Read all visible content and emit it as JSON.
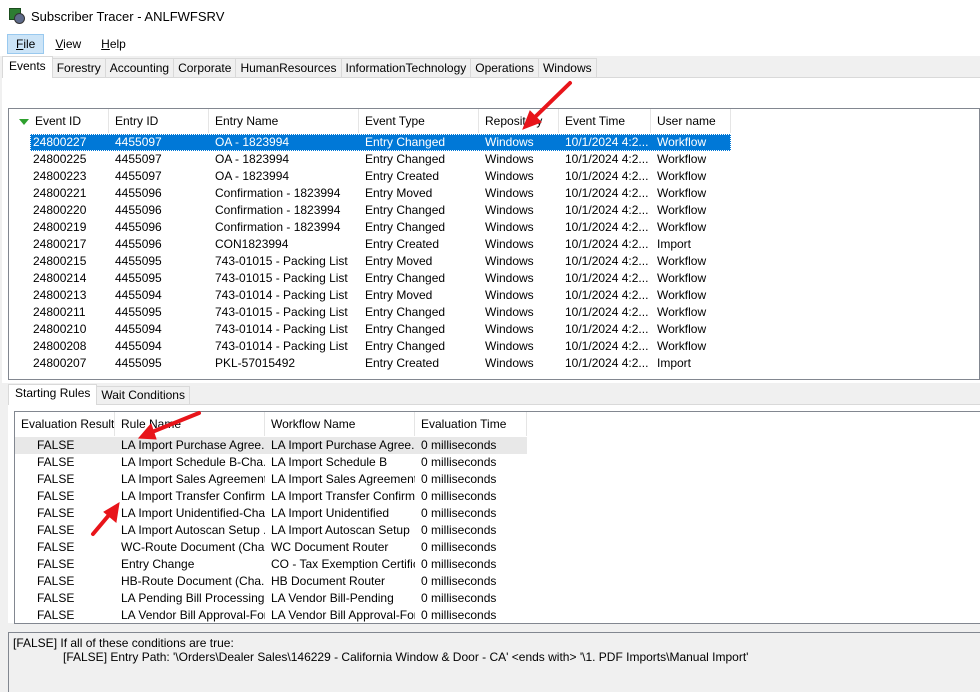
{
  "window": {
    "title": "Subscriber Tracer - ANLFWFSRV"
  },
  "menu": [
    {
      "label_u": "F",
      "label_rest": "ile"
    },
    {
      "label_u": "V",
      "label_rest": "iew"
    },
    {
      "label_u": "H",
      "label_rest": "elp"
    }
  ],
  "tabs": [
    "Events",
    "Forestry",
    "Accounting",
    "Corporate",
    "HumanResources",
    "InformationTechnology",
    "Operations",
    "Windows"
  ],
  "events": {
    "columns": [
      "Event ID",
      "Entry ID",
      "Entry Name",
      "Event Type",
      "Repository",
      "Event Time",
      "User name"
    ],
    "rows": [
      [
        "24800227",
        "4455097",
        "OA - 1823994",
        "Entry Changed",
        "Windows",
        "10/1/2024 4:2...",
        "Workflow"
      ],
      [
        "24800225",
        "4455097",
        "OA - 1823994",
        "Entry Changed",
        "Windows",
        "10/1/2024 4:2...",
        "Workflow"
      ],
      [
        "24800223",
        "4455097",
        "OA - 1823994",
        "Entry Created",
        "Windows",
        "10/1/2024 4:2...",
        "Workflow"
      ],
      [
        "24800221",
        "4455096",
        "Confirmation - 1823994",
        "Entry Moved",
        "Windows",
        "10/1/2024 4:2...",
        "Workflow"
      ],
      [
        "24800220",
        "4455096",
        "Confirmation - 1823994",
        "Entry Changed",
        "Windows",
        "10/1/2024 4:2...",
        "Workflow"
      ],
      [
        "24800219",
        "4455096",
        "Confirmation - 1823994",
        "Entry Changed",
        "Windows",
        "10/1/2024 4:2...",
        "Workflow"
      ],
      [
        "24800217",
        "4455096",
        "CON1823994",
        "Entry Created",
        "Windows",
        "10/1/2024 4:2...",
        "Import"
      ],
      [
        "24800215",
        "4455095",
        "743-01015 - Packing List",
        "Entry Moved",
        "Windows",
        "10/1/2024 4:2...",
        "Workflow"
      ],
      [
        "24800214",
        "4455095",
        "743-01015 - Packing List",
        "Entry Changed",
        "Windows",
        "10/1/2024 4:2...",
        "Workflow"
      ],
      [
        "24800213",
        "4455094",
        "743-01014 - Packing List",
        "Entry Moved",
        "Windows",
        "10/1/2024 4:2...",
        "Workflow"
      ],
      [
        "24800211",
        "4455095",
        "743-01015 - Packing List",
        "Entry Changed",
        "Windows",
        "10/1/2024 4:2...",
        "Workflow"
      ],
      [
        "24800210",
        "4455094",
        "743-01014 - Packing List",
        "Entry Changed",
        "Windows",
        "10/1/2024 4:2...",
        "Workflow"
      ],
      [
        "24800208",
        "4455094",
        "743-01014 - Packing List",
        "Entry Changed",
        "Windows",
        "10/1/2024 4:2...",
        "Workflow"
      ],
      [
        "24800207",
        "4455095",
        "PKL-57015492",
        "Entry Created",
        "Windows",
        "10/1/2024 4:2...",
        "Import"
      ]
    ]
  },
  "subtabs": [
    "Starting Rules",
    "Wait Conditions"
  ],
  "rules": {
    "columns": [
      "Evaluation Result",
      "Rule Name",
      "Workflow Name",
      "Evaluation Time"
    ],
    "rows": [
      [
        "FALSE",
        "LA Import Purchase Agree...",
        "LA Import Purchase Agree...",
        "0 milliseconds"
      ],
      [
        "FALSE",
        "LA Import Schedule B-Cha...",
        "LA Import Schedule B",
        "0 milliseconds"
      ],
      [
        "FALSE",
        "LA Import Sales Agreement...",
        "LA Import Sales Agreement",
        "0 milliseconds"
      ],
      [
        "FALSE",
        "LA Import Transfer Confirm...",
        "LA Import Transfer Confirm...",
        "0 milliseconds"
      ],
      [
        "FALSE",
        "LA Import Unidentified-Cha...",
        "LA Import Unidentified",
        "0 milliseconds"
      ],
      [
        "FALSE",
        "LA Import Autoscan Setup ...",
        "LA Import Autoscan Setup",
        "0 milliseconds"
      ],
      [
        "FALSE",
        "WC-Route Document (Cha...",
        "WC Document Router",
        "0 milliseconds"
      ],
      [
        "FALSE",
        "Entry Change",
        "CO - Tax Exemption Certific...",
        "0 milliseconds"
      ],
      [
        "FALSE",
        "HB-Route Document (Cha...",
        "HB Document Router",
        "0 milliseconds"
      ],
      [
        "FALSE",
        "LA Pending Bill Processing ...",
        "LA Vendor Bill-Pending",
        "0 milliseconds"
      ],
      [
        "FALSE",
        "LA Vendor Bill Approval-For...",
        "LA Vendor Bill Approval-For...",
        "0 milliseconds"
      ]
    ]
  },
  "details": {
    "line1": "[FALSE] If all of these conditions are true:",
    "line2": "[FALSE] Entry Path: '\\Orders\\Dealer Sales\\146229 - California Window & Door - CA' <ends with> '\\1. PDF Imports\\Manual Import'"
  },
  "colors": {
    "selection": "#0078d7",
    "annotation_arrow": "#e8141a",
    "sort_arrow": "#2ea02e"
  }
}
